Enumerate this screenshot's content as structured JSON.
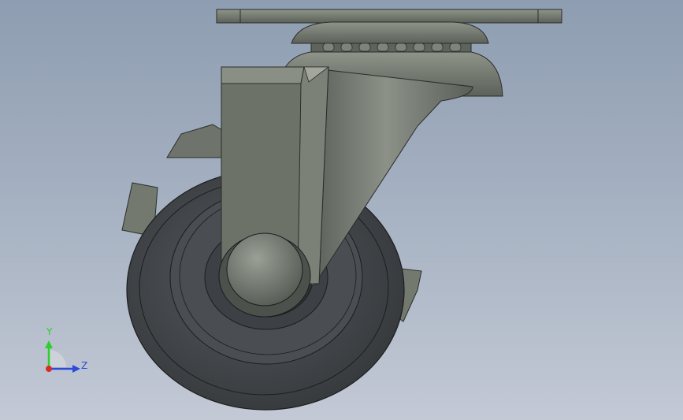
{
  "viewport": {
    "background_top": "#8e9db1",
    "background_bottom": "#c3c9d5"
  },
  "model": {
    "name": "swivel-caster-with-brake",
    "part_color": "#6c7168",
    "wheel_color": "#45484c"
  },
  "triad": {
    "y_label": "Y",
    "z_label": "Z",
    "y_color": "#2bd02b",
    "z_color": "#2b4bd8",
    "x_color": "#d82b2b"
  }
}
